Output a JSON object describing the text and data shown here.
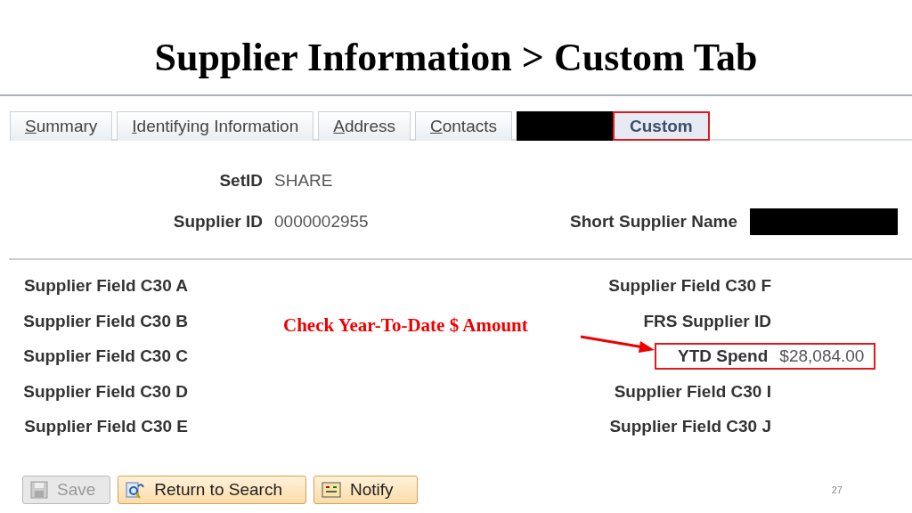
{
  "slide_title": "Supplier Information > Custom Tab",
  "tabs": [
    {
      "label": "Summary",
      "kind": "text",
      "selected": false,
      "underlined_initial": true
    },
    {
      "label": "Identifying Information",
      "kind": "text",
      "selected": false,
      "underlined_initial": true
    },
    {
      "label": "Address",
      "kind": "text",
      "selected": false,
      "underlined_initial": true
    },
    {
      "label": "Contacts",
      "kind": "text",
      "selected": false,
      "underlined_initial": true
    },
    {
      "kind": "redacted"
    },
    {
      "label": "Custom",
      "kind": "text",
      "selected": true,
      "underlined_initial": false
    }
  ],
  "header": {
    "setid_label": "SetID",
    "setid": "SHARE",
    "supplier_id_label": "Supplier ID",
    "supplier_id": "0000002955",
    "short_name_label": "Short Supplier Name",
    "short_name_redacted": true
  },
  "left_fields": [
    {
      "label": "Supplier Field C30 A"
    },
    {
      "label": "Supplier Field C30 B"
    },
    {
      "label": "Supplier Field C30 C"
    },
    {
      "label": "Supplier Field C30 D"
    },
    {
      "label": "Supplier Field C30 E"
    }
  ],
  "right_fields": [
    {
      "label": "Supplier Field C30 F",
      "highlighted": false
    },
    {
      "label": "FRS Supplier ID",
      "highlighted": false
    },
    {
      "label": "YTD Spend",
      "value": "$28,084.00",
      "highlighted": true
    },
    {
      "label": "Supplier Field C30 I",
      "highlighted": false
    },
    {
      "label": "Supplier Field C30 J",
      "highlighted": false
    }
  ],
  "annotation": "Check Year-To-Date $ Amount",
  "buttons": [
    {
      "label": "Save",
      "kind": "save",
      "disabled": true
    },
    {
      "label": "Return to Search",
      "kind": "search",
      "disabled": false
    },
    {
      "label": "Notify",
      "kind": "notify",
      "disabled": false
    }
  ],
  "page_number": "27"
}
